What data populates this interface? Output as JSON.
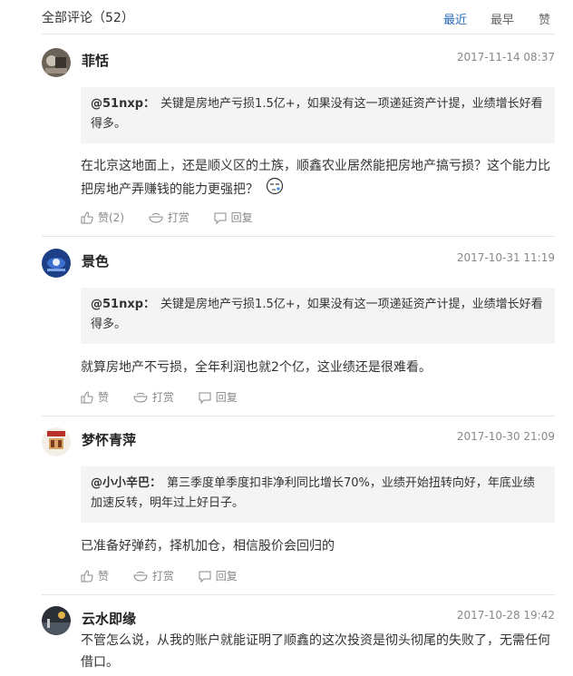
{
  "header": {
    "title": "全部评论（52）",
    "sort_latest": "最近",
    "sort_earliest": "最早",
    "sort_likes": "赞"
  },
  "comments": [
    {
      "user": "菲恬",
      "time": "2017-11-14 08:37",
      "quote_user": "@51nxp：",
      "quote_text": "关键是房地产亏损1.5亿+，如果没有这一项递延资产计提，业绩增长好看得多。",
      "body": "在北京这地面上，还是顺义区的土族，顺鑫农业居然能把房地产搞亏损？这个能力比把房地产弄赚钱的能力更强把？",
      "like_label": "赞(2)",
      "tip_label": "打赏",
      "reply_label": "回复"
    },
    {
      "user": "景色",
      "time": "2017-10-31 11:19",
      "quote_user": "@51nxp：",
      "quote_text": "关键是房地产亏损1.5亿+，如果没有这一项递延资产计提，业绩增长好看得多。",
      "body": "就算房地产不亏损，全年利润也就2个亿，这业绩还是很难看。",
      "like_label": "赞",
      "tip_label": "打赏",
      "reply_label": "回复"
    },
    {
      "user": "梦怀青萍",
      "time": "2017-10-30 21:09",
      "quote_user": "@小小辛巴：",
      "quote_text": "第三季度单季度扣非净利同比增长70%，业绩开始扭转向好，年底业绩加速反转，明年过上好日子。",
      "body": "已准备好弹药，择机加仓，相信股价会回归的",
      "like_label": "赞",
      "tip_label": "打赏",
      "reply_label": "回复"
    },
    {
      "user": "云水即缘",
      "time": "2017-10-28 19:42",
      "body": "不管怎么说，从我的账户就能证明了顺鑫的这次投资是彻头彻尾的失败了，无需任何借口。"
    }
  ],
  "colors": {
    "accent": "#2a6eb8",
    "quote_bg": "#f4f4f4",
    "meta": "#888888"
  }
}
